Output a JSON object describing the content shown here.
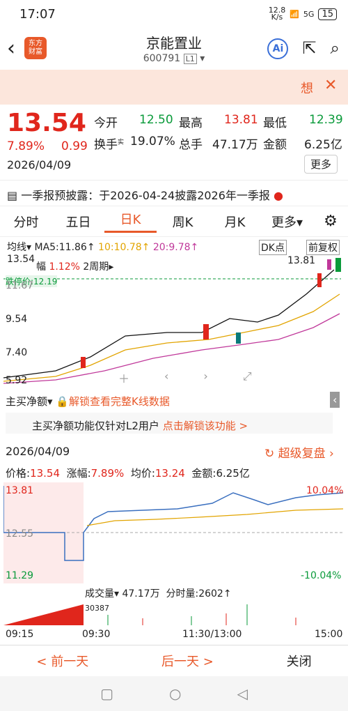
{
  "status": {
    "time": "17:07",
    "speed_top": "12.8",
    "speed_bottom": "K/s",
    "battery": "15",
    "signal": "5G"
  },
  "header": {
    "title": "京能置业",
    "code": "600791",
    "code_badge": "L1",
    "logo_line1": "东方",
    "logo_line2": "财富",
    "ai_label": "Ai"
  },
  "banner": {
    "text": "想"
  },
  "quote": {
    "price": "13.54",
    "change_pct": "7.89%",
    "change": "0.99",
    "date": "2026/04/09",
    "open_label": "今开",
    "open": "12.50",
    "high_label": "最高",
    "high": "13.81",
    "low_label": "最低",
    "low": "12.39",
    "turnover_label": "换手",
    "turnover_sup": "实",
    "turnover": "19.07%",
    "vol_label": "总手",
    "vol": "47.17万",
    "amount_label": "金额",
    "amount": "6.25亿",
    "more": "更多"
  },
  "notice": {
    "text": "一季报预披露：于2026-04-24披露2026年一季报"
  },
  "tabs": [
    "分时",
    "五日",
    "日K",
    "周K",
    "月K",
    "更多"
  ],
  "kchart": {
    "ma_label": "均线",
    "ma5": "MA5:11.86↑",
    "ma10": "10:10.78↑",
    "ma20": "20:9.78↑",
    "dk": "DK点",
    "fuquan": "前复权",
    "y1": "13.54",
    "y2": "11.67",
    "y3": "9.54",
    "y4": "7.40",
    "y5": "5.92",
    "range_label": "幅",
    "range_val": "1.12%",
    "period": "2周期",
    "limit": "跌停价:12.19",
    "peak": "13.81",
    "sub_label": "主买净额",
    "unlock": "解锁查看完整K线数据",
    "unlock2": "主买净额功能仅针对L2用户",
    "unlock3": "点击解锁该功能 >"
  },
  "intraday": {
    "date": "2026/04/09",
    "super": "超级复盘",
    "price_label": "价格:",
    "price": "13.54",
    "chg_label": "涨幅:",
    "chg": "7.89%",
    "avg_label": "均价:",
    "avg": "13.24",
    "amt_label": "金额:",
    "amt": "6.25亿",
    "ytop": "13.81",
    "ymid": "12.55",
    "ybot": "11.29",
    "pct_top": "10.04%",
    "pct_bot": "-10.04%",
    "vol_label": "成交量",
    "vol": "47.17万",
    "tick_label": "分时量:",
    "tick": "2602↑",
    "vol_max": "30387",
    "t1": "09:15",
    "t2": "09:30",
    "t3": "11:30/13:00",
    "t4": "15:00"
  },
  "bottom": {
    "prev": "< 前一天",
    "next": "后一天 >",
    "close": "关闭"
  },
  "colors": {
    "red": "#e0261c",
    "green": "#0a9a3a",
    "accent": "#e8592a"
  }
}
